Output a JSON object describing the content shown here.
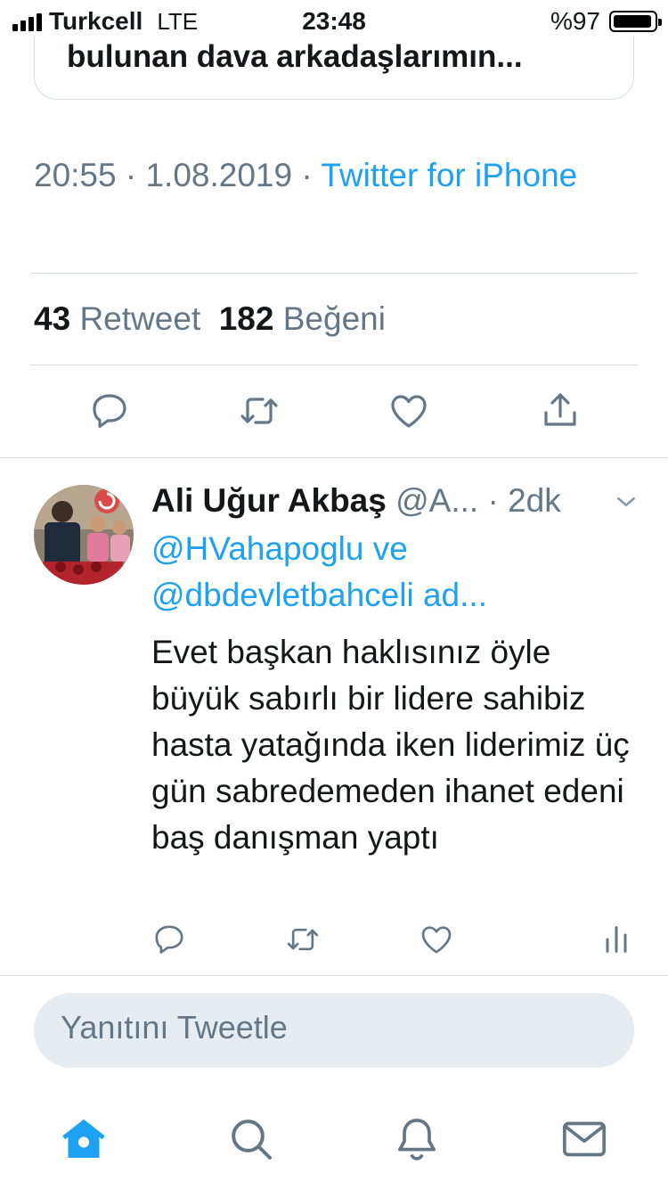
{
  "status_bar": {
    "carrier": "Turkcell",
    "network": "LTE",
    "time": "23:48",
    "battery": "%97"
  },
  "quoted_tweet": {
    "text": "bulunan dava arkadaşlarımın..."
  },
  "tweet_meta": {
    "time": "20:55",
    "separator": " · ",
    "date": "1.08.2019",
    "source": "Twitter for iPhone"
  },
  "stats": {
    "retweets": "43",
    "retweets_label": "Retweet",
    "likes": "182",
    "likes_label": "Beğeni"
  },
  "actions": [
    "reply-icon",
    "retweet-icon",
    "like-icon",
    "share-icon"
  ],
  "reply": {
    "name": "Ali Uğur Akbaş",
    "handle": "@A...",
    "time": " · 2dk",
    "replying_to": "@HVahapoglu ve @dbdevletbahceli ad...",
    "text": "Evet başkan haklısınız öyle büyük sabırlı bir lidere sahibiz hasta yatağında iken liderimiz üç gün sabredemeden ihanet edeni baş danışman yaptı"
  },
  "reply_box": {
    "placeholder": "Yanıtını Tweetle"
  },
  "tab_bar": [
    "home-icon",
    "search-icon",
    "notifications-icon",
    "messages-icon"
  ],
  "colors": {
    "accent": "#1da1f2",
    "secondary_text": "#657786",
    "primary_text": "#14171a",
    "divider": "#d8dee3",
    "input_bg": "#e6ecf0"
  }
}
